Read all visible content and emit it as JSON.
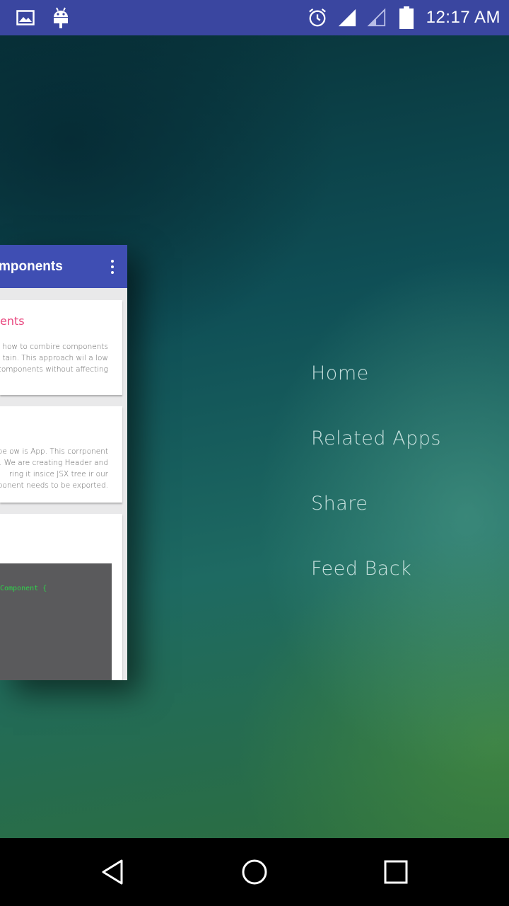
{
  "status_bar": {
    "time": "12:17 AM",
    "icons": [
      "image-icon",
      "android-icon",
      "alarm-icon",
      "signal-icon",
      "signal-empty-icon",
      "battery-icon"
    ]
  },
  "menu": {
    "items": [
      {
        "label": "Home"
      },
      {
        "label": "Related Apps"
      },
      {
        "label": "Share"
      },
      {
        "label": "Feed Back"
      }
    ]
  },
  "preview": {
    "title": "mponents",
    "cards": [
      {
        "heading": "ents",
        "lines": [
          "how to combire components",
          "tain. This approach wil a low",
          "r components without affecting"
        ]
      },
      {
        "lines": [
          "e be ow is App. This corrponent",
          "t. We are creating Header and",
          "ring it insice JSX tree ir our",
          "rponent needs to be exported."
        ]
      },
      {
        "code": "Component {"
      }
    ]
  },
  "nav_bar": {
    "buttons": [
      "back-icon",
      "home-icon",
      "recents-icon"
    ]
  },
  "colors": {
    "status_bar": "#3a46a0",
    "toolbar": "#3f4eb3",
    "accent_pink": "#e8457d",
    "code_green": "#2fd14a"
  }
}
